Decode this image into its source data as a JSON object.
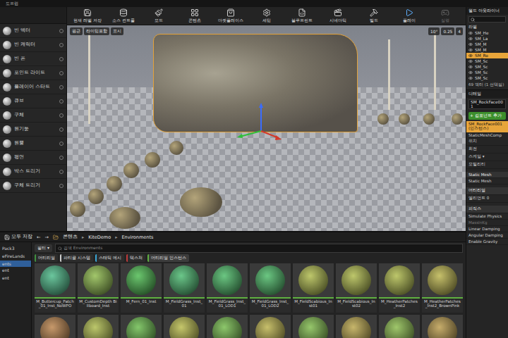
{
  "window": {
    "tab": "도프랩"
  },
  "toolbar": {
    "buttons": [
      {
        "label": "현재 레벨 저장",
        "disabled": false
      },
      {
        "label": "소스 컨트롤",
        "disabled": false
      },
      {
        "label": "모드",
        "disabled": false
      },
      {
        "label": "콘텐츠",
        "disabled": false
      },
      {
        "label": "마켓플레이스",
        "disabled": false
      },
      {
        "label": "세팅",
        "disabled": false
      },
      {
        "label": "블루프린트",
        "disabled": false
      },
      {
        "label": "시네마틱",
        "disabled": false
      },
      {
        "label": "빌드",
        "disabled": false
      },
      {
        "label": "플레이",
        "disabled": false
      },
      {
        "label": "실행",
        "disabled": true
      }
    ]
  },
  "place_modes": {
    "items": [
      "빈 액터",
      "빈 캐릭터",
      "빈 폰",
      "포인트 라이트",
      "플레이어 스타트",
      "큐브",
      "구체",
      "원기둥",
      "원뿔",
      "평면",
      "박스 트리거",
      "구체 트리거"
    ]
  },
  "viewport": {
    "view": "원근",
    "lighting": "라이팅포함",
    "show": "표시",
    "rotation_snap": "10°",
    "scale_snap": "0.25",
    "camera_speed": "4"
  },
  "outliner": {
    "title": "월드 아웃라이너",
    "column": "라벨",
    "items": [
      {
        "label": "SM_He",
        "selected": false
      },
      {
        "label": "SM_La",
        "selected": false
      },
      {
        "label": "SM_M",
        "selected": false
      },
      {
        "label": "SM_M",
        "selected": false
      },
      {
        "label": "SM_Ro",
        "selected": true
      },
      {
        "label": "SM_Sc",
        "selected": false
      },
      {
        "label": "SM_Sc",
        "selected": false
      },
      {
        "label": "SM_Sc",
        "selected": false
      },
      {
        "label": "SM_Sc",
        "selected": false
      }
    ],
    "count": "69 액터 (1 선택됨)"
  },
  "details": {
    "title": "디테일",
    "name": "SM_RockFace001",
    "add_component": "+ 컴포넌트 추가",
    "components": [
      {
        "label": "SM_RockFace001 (인스턴스)",
        "selected": true
      },
      {
        "label": "StaticMeshComp",
        "selected": false
      }
    ],
    "rows": [
      {
        "label": "위치",
        "kind": "row"
      },
      {
        "label": "회전",
        "kind": "row"
      },
      {
        "label": "스케일 ▾",
        "kind": "row"
      },
      {
        "label": "모빌리티",
        "kind": "row"
      },
      {
        "label": "Static Mesh",
        "kind": "section"
      },
      {
        "label": "Static Mesh",
        "kind": "row"
      },
      {
        "label": "머티리얼",
        "kind": "section"
      },
      {
        "label": "엘리먼트 0",
        "kind": "row"
      },
      {
        "label": "피직스",
        "kind": "section"
      },
      {
        "label": "Simulate Physics",
        "kind": "row"
      },
      {
        "label": "MassInKg",
        "kind": "disabled"
      },
      {
        "label": "Linear Damping",
        "kind": "row"
      },
      {
        "label": "Angular Damping",
        "kind": "row"
      },
      {
        "label": "Enable Gravity",
        "kind": "row"
      }
    ]
  },
  "content_browser": {
    "save_all": "모두 저장",
    "back": "←",
    "forward": "→",
    "separator": "▸",
    "path": [
      "콘텐츠",
      "KiteDemo",
      "Environments"
    ],
    "tree": [
      {
        "label": "Pack3",
        "selected": false
      },
      {
        "label": "eFireLands",
        "selected": false
      },
      {
        "label": "ents",
        "selected": true
      },
      {
        "label": "ent",
        "selected": false
      },
      {
        "label": "ent",
        "selected": false
      }
    ],
    "filter": "필터 ▾",
    "search": {
      "placeholder": "검색 Environments"
    },
    "chips": [
      {
        "label": "머티리얼",
        "color": "#3f8f3f",
        "active": false
      },
      {
        "label": "파티클 시스템",
        "color": "#d0d0d0",
        "active": false
      },
      {
        "label": "스태틱 메시",
        "color": "#39a6d6",
        "active": false
      },
      {
        "label": "텍스처",
        "color": "#c03a3a",
        "active": false
      },
      {
        "label": "머티리얼 인스턴스",
        "color": "#5fb040",
        "active": true
      }
    ],
    "assets": [
      "M_Buttercup_Patch_01_Inst_NoWPO",
      "M_CustomDepth Billboard_Inst",
      "M_Fern_01_Inst",
      "M_FieldGrass_Inst_01",
      "M_FieldGrass_Inst_01_LOD1",
      "M_FieldGrass_Inst_01_LOD2",
      "M_FieldScabious_Inst01",
      "M_FieldScabious_Inst02",
      "M_HeatherPatches_Inst2",
      "M_HeatherPatches_Inst2_BrownPink"
    ]
  }
}
